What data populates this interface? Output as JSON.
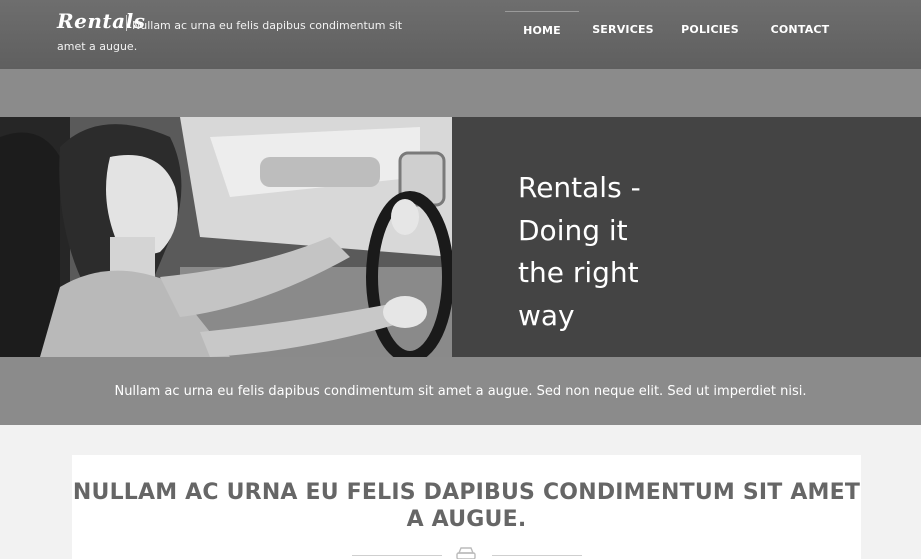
{
  "header": {
    "logo": "Rentals",
    "tagline": "Nullam ac urna eu felis dapibus condimentum sit amet a augue."
  },
  "nav": {
    "items": [
      {
        "label": "HOME",
        "active": true
      },
      {
        "label": "SERVICES",
        "active": false
      },
      {
        "label": "POLICIES",
        "active": false
      },
      {
        "label": "CONTACT",
        "active": false
      }
    ]
  },
  "hero": {
    "title": "Rentals - Doing it the right way",
    "image": "woman-driving-car-photo"
  },
  "band": {
    "text": "Nullam ac urna eu felis dapibus condimentum sit amet a augue. Sed non neque elit. Sed ut imperdiet nisi."
  },
  "content": {
    "heading": "NULLAM AC URNA EU FELIS DAPIBUS CONDIMENTUM SIT AMET A AUGUE.",
    "divider_icon": "car-icon"
  },
  "colors": {
    "header_bg": "#666666",
    "band_bg": "#8b8b8b",
    "hero_panel_bg": "#444444",
    "heading_text": "#666666"
  }
}
